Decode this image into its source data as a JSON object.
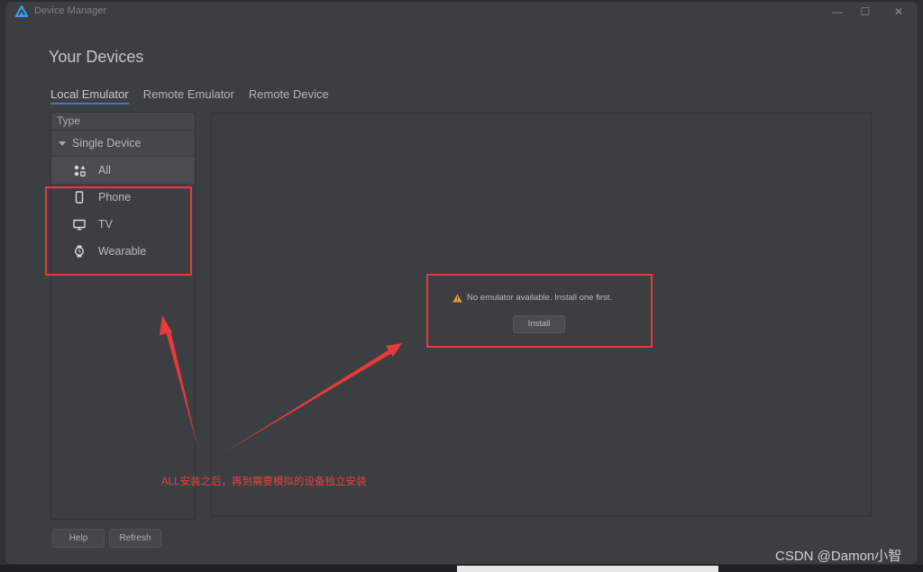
{
  "window": {
    "title": "Device Manager",
    "controls": {
      "minimize": "—",
      "maximize": "☐",
      "close": "✕"
    }
  },
  "heading": "Your Devices",
  "tabs": [
    {
      "label": "Local Emulator",
      "active": true
    },
    {
      "label": "Remote Emulator",
      "active": false
    },
    {
      "label": "Remote Device",
      "active": false
    }
  ],
  "sidebar": {
    "header": "Type",
    "group": {
      "label": "Single Device",
      "expanded": true
    },
    "items": [
      {
        "label": "All",
        "icon": "apps-grid-icon",
        "selected": true
      },
      {
        "label": "Phone",
        "icon": "phone-icon",
        "selected": false
      },
      {
        "label": "TV",
        "icon": "tv-icon",
        "selected": false
      },
      {
        "label": "Wearable",
        "icon": "watch-icon",
        "selected": false
      }
    ]
  },
  "main": {
    "empty_message": "No emulator available. Install one first.",
    "install_label": "Install",
    "warning_color": "#e8a33a"
  },
  "footer": {
    "help_label": "Help",
    "refresh_label": "Refresh"
  },
  "annotation": {
    "text": "ALL安装之后，再到需要模拟的设备独立安装",
    "color": "#e83a3a"
  },
  "watermark": "CSDN @Damon小智",
  "accent_color": "#3f76c5"
}
